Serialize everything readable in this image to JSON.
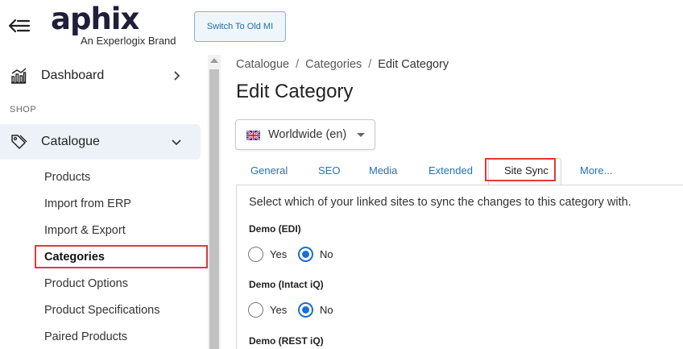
{
  "header": {
    "logo_text": "aphix",
    "logo_tagline": "An Experlogix Brand",
    "switch_button": "Switch To Old MI"
  },
  "sidebar": {
    "dashboard": "Dashboard",
    "section_shop": "SHOP",
    "catalogue": "Catalogue",
    "sub_items": [
      "Products",
      "Import from ERP",
      "Import & Export",
      "Categories",
      "Product Options",
      "Product Specifications",
      "Paired Products"
    ],
    "active_sub_item": "Categories"
  },
  "breadcrumb": {
    "items": [
      "Catalogue",
      "Categories",
      "Edit Category"
    ],
    "separator": "/"
  },
  "page_title": "Edit Category",
  "language_select": {
    "value": "Worldwide (en)",
    "flag": "uk-flag-icon"
  },
  "tabs": {
    "items": [
      "General",
      "SEO",
      "Media",
      "Extended",
      "Site Sync",
      "More..."
    ],
    "active": "Site Sync"
  },
  "site_sync": {
    "intro": "Select which of your linked sites to sync the changes to this category with.",
    "sites": [
      {
        "name": "Demo (EDI)",
        "yes_label": "Yes",
        "no_label": "No",
        "selected": "No"
      },
      {
        "name": "Demo (Intact iQ)",
        "yes_label": "Yes",
        "no_label": "No",
        "selected": "No"
      },
      {
        "name": "Demo (REST iQ)"
      }
    ]
  },
  "colors": {
    "accent_blue": "#1a6fd1",
    "link_blue": "#2474b5",
    "highlight_red": "#e03a3a",
    "sidebar_active_bg": "#edf2f8"
  }
}
